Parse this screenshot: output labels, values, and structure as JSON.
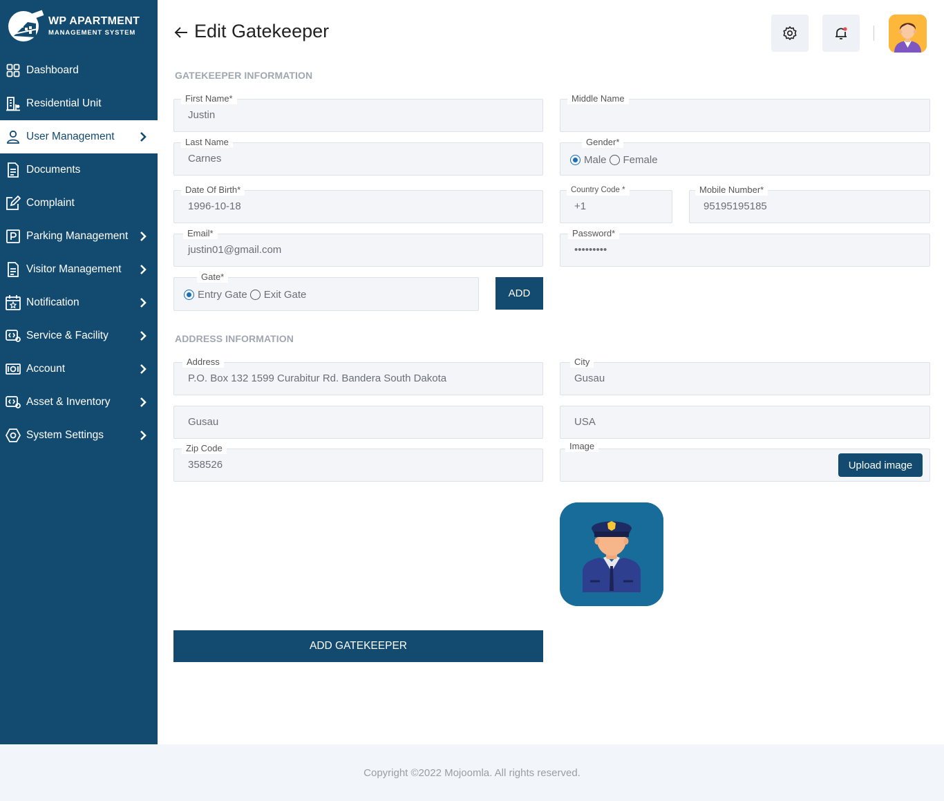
{
  "brand": {
    "title": "WP APARTMENT",
    "subtitle": "MANAGEMENT SYSTEM"
  },
  "sidebar": {
    "items": [
      {
        "label": "Dashboard",
        "icon": "dashboard-grid-icon",
        "chevron": false
      },
      {
        "label": "Residential Unit",
        "icon": "building-icon",
        "chevron": false
      },
      {
        "label": "User Management",
        "icon": "user-icon",
        "chevron": true,
        "active": true
      },
      {
        "label": "Documents",
        "icon": "document-icon",
        "chevron": false
      },
      {
        "label": "Complaint",
        "icon": "edit-icon",
        "chevron": false
      },
      {
        "label": "Parking Management",
        "icon": "parking-icon",
        "chevron": true
      },
      {
        "label": "Visitor Management",
        "icon": "visitor-document-icon",
        "chevron": true
      },
      {
        "label": "Notification",
        "icon": "calendar-star-icon",
        "chevron": true
      },
      {
        "label": "Service & Facility",
        "icon": "service-icon",
        "chevron": true
      },
      {
        "label": "Account",
        "icon": "money-icon",
        "chevron": true
      },
      {
        "label": "Asset & Inventory",
        "icon": "inventory-icon",
        "chevron": true
      },
      {
        "label": "System Settings",
        "icon": "settings-hex-icon",
        "chevron": true
      }
    ]
  },
  "header": {
    "title": "Edit Gatekeeper"
  },
  "sections": {
    "gatekeeper": "GATEKEEPER INFORMATION",
    "address": "ADDRESS INFORMATION"
  },
  "form": {
    "first_name": {
      "label": "First Name*",
      "value": "Justin"
    },
    "middle_name": {
      "label": "Middle Name",
      "value": ""
    },
    "last_name": {
      "label": "Last Name",
      "value": "Carnes"
    },
    "gender": {
      "label": "Gender*",
      "options": [
        "Male",
        "Female"
      ],
      "selected": "Male"
    },
    "dob": {
      "label": "Date Of Birth*",
      "value": "1996-10-18"
    },
    "country_code": {
      "label": "Country Code *",
      "value": "+1"
    },
    "mobile": {
      "label": "Mobile Number*",
      "value": "95195195185"
    },
    "email": {
      "label": "Email*",
      "value": "justin01@gmail.com"
    },
    "password": {
      "label": "Password*",
      "value": "•••••••••"
    },
    "gate": {
      "label": "Gate*",
      "options": [
        "Entry Gate",
        "Exit Gate"
      ],
      "selected": "Entry Gate"
    },
    "add_button": "ADD",
    "address": {
      "label": "Address",
      "value": "P.O. Box 132 1599 Curabitur Rd. Bandera South Dakota"
    },
    "city": {
      "label": "City",
      "value": "Gusau"
    },
    "state": {
      "value": "Gusau"
    },
    "country": {
      "value": "USA"
    },
    "zip": {
      "label": "Zip Code",
      "value": "358526"
    },
    "image": {
      "label": "Image",
      "button": "Upload image"
    },
    "submit": "ADD GATEKEEPER"
  },
  "footer": {
    "text": "Copyright ©2022 Mojoomla. All rights reserved."
  },
  "colors": {
    "sidebar": "#124A70",
    "accent": "#124A70",
    "field_bg": "#F3F5F8",
    "guard_bg": "#176C99"
  }
}
